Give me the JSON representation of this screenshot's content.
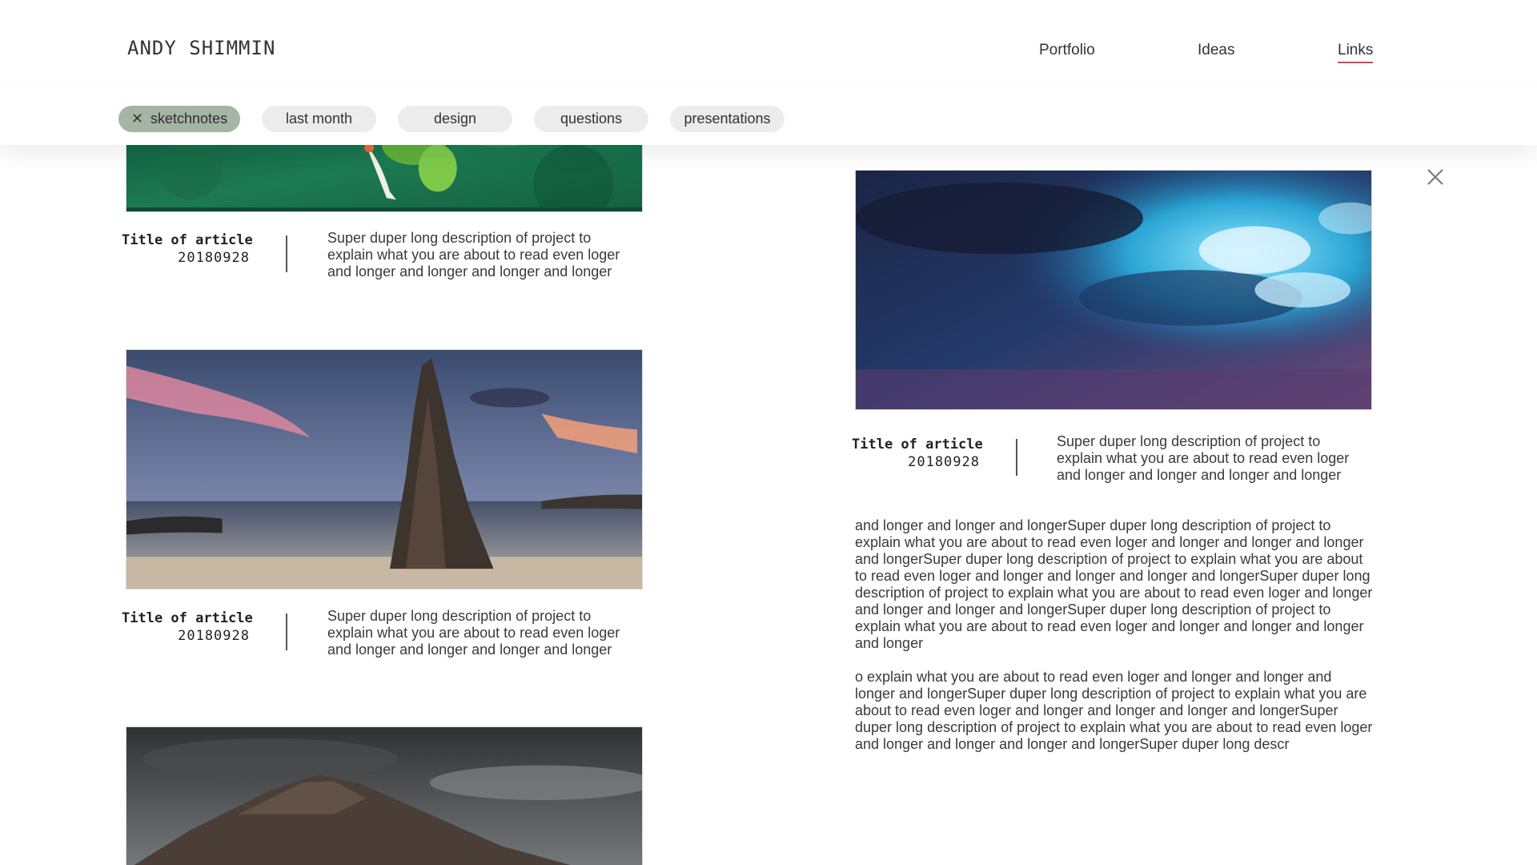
{
  "header": {
    "brand": "ANDY SHIMMIN",
    "nav": [
      {
        "label": "Portfolio"
      },
      {
        "label": "Ideas"
      },
      {
        "label": "Links",
        "active": true
      }
    ],
    "active_underline_color": "#d2475a"
  },
  "filters": [
    {
      "label": "sketchnotes",
      "active": true,
      "remove_icon": "close-icon"
    },
    {
      "label": "last month",
      "active": false
    },
    {
      "label": "design",
      "active": false
    },
    {
      "label": "questions",
      "active": false
    },
    {
      "label": "presentations",
      "active": false
    }
  ],
  "articles": [
    {
      "image": "koi-pond-image",
      "title": "Title of article",
      "date": "20180928",
      "description": "Super duper long description of project to explain what you are about to read even loger and longer and longer and longer and longer"
    },
    {
      "image": "sea-stack-sunset-image",
      "title": "Title of article",
      "date": "20180928",
      "description": "Super duper long description of project to explain what you are about to read even loger and longer and longer and longer and longer"
    },
    {
      "image": "mountain-storm-image"
    }
  ],
  "detail": {
    "close_icon": "close-icon",
    "image": "sky-clouds-image",
    "title": "Title of article",
    "date": "20180928",
    "description": "Super duper long description of project to explain what you are about to read even loger and longer and longer and longer and longer",
    "paragraphs": [
      "and longer and longer and longerSuper duper long description of project to explain what you are about to read even loger and longer and longer and longer and longerSuper duper long description of project to explain what you are about to read even loger and longer and longer and longer and longerSuper duper long description of project to explain what you are about to read even loger and longer and longer and longer and longerSuper duper long description of project to explain what you are about to read even loger and longer and longer and longer and longer",
      "o explain what you are about to read even loger and longer and longer and longer and longerSuper duper long description of project to explain what you are about to read even loger and longer and longer and longer and longerSuper duper long description of project to explain what you are about to read even loger and longer and longer and longer and longerSuper duper long descr"
    ]
  },
  "colors": {
    "chip_default": "#ececec",
    "chip_active": "#a5b5a5",
    "text": "#3a3a3a"
  }
}
